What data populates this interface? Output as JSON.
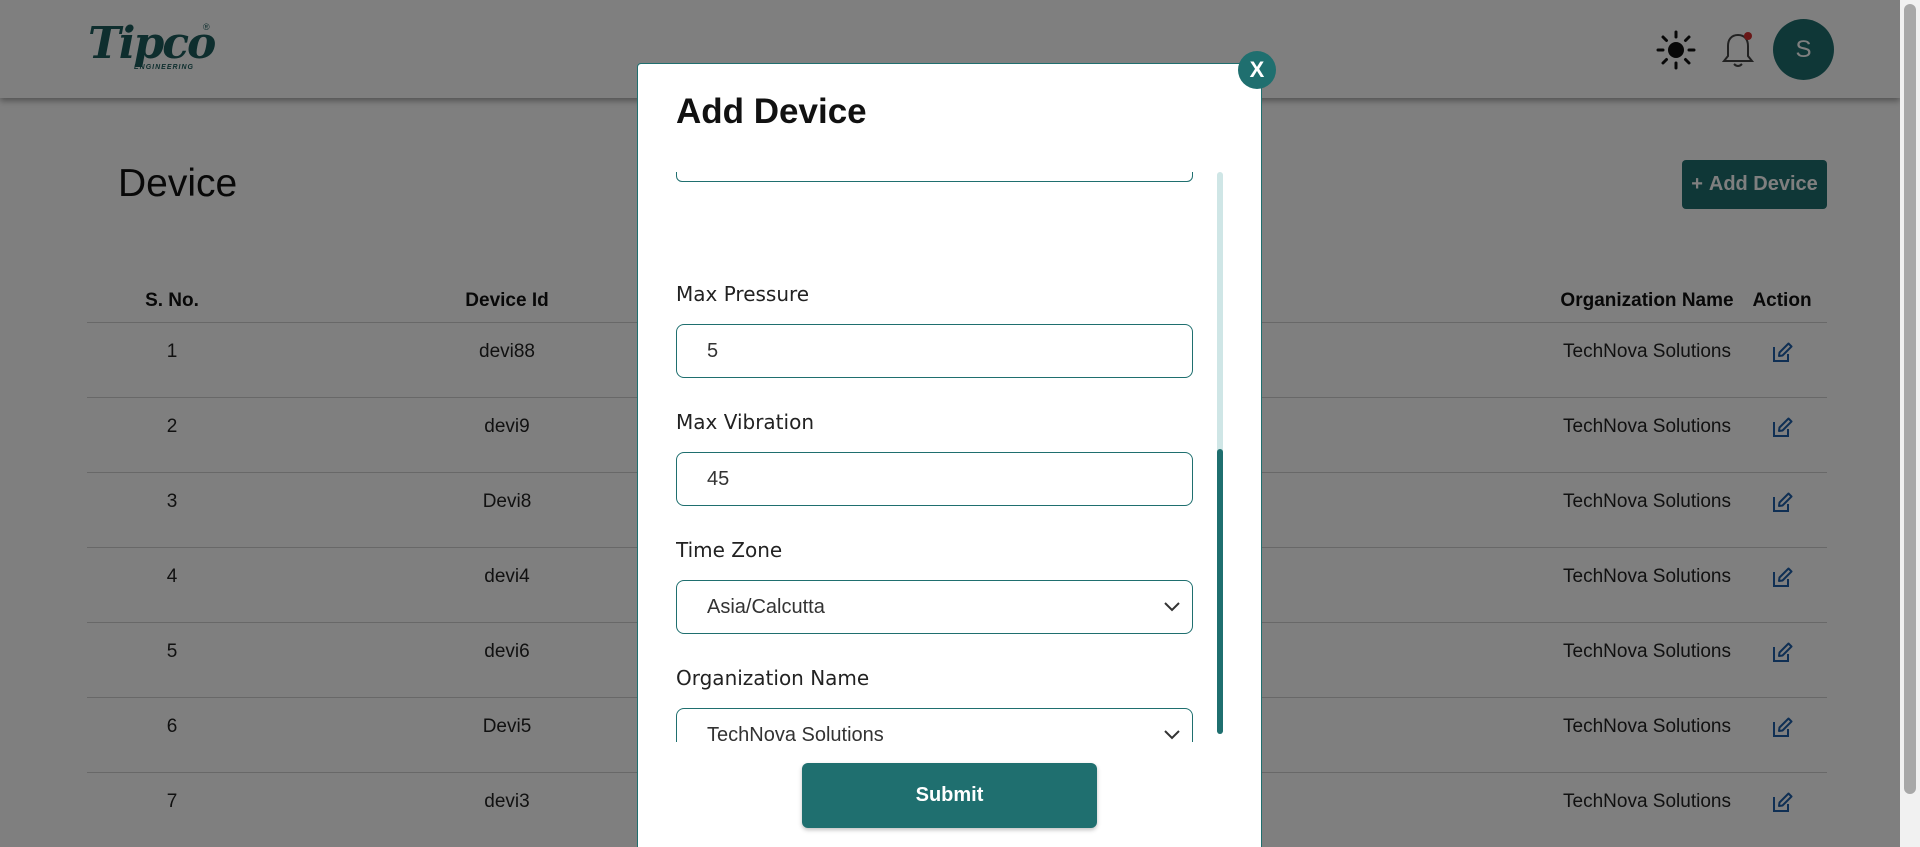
{
  "app": {
    "logo_text": "Tipco",
    "logo_sub": "ENGINEERING",
    "logo_reg": "®"
  },
  "header": {
    "avatar_initial": "S"
  },
  "page": {
    "title": "Device",
    "add_button_label": "Add Device",
    "add_button_plus": "+"
  },
  "table": {
    "headers": {
      "sno": "S. No.",
      "device_id": "Device Id",
      "organization": "Organization Name",
      "action": "Action"
    },
    "rows": [
      {
        "sno": "1",
        "device_id": "devi88",
        "organization": "TechNova Solutions"
      },
      {
        "sno": "2",
        "device_id": "devi9",
        "organization": "TechNova Solutions"
      },
      {
        "sno": "3",
        "device_id": "Devi8",
        "organization": "TechNova Solutions"
      },
      {
        "sno": "4",
        "device_id": "devi4",
        "organization": "TechNova Solutions"
      },
      {
        "sno": "5",
        "device_id": "devi6",
        "organization": "TechNova Solutions"
      },
      {
        "sno": "6",
        "device_id": "Devi5",
        "organization": "TechNova Solutions"
      },
      {
        "sno": "7",
        "device_id": "devi3",
        "organization": "TechNova Solutions"
      }
    ]
  },
  "modal": {
    "title": "Add Device",
    "close_label": "X",
    "fields": {
      "max_pressure": {
        "label": "Max Pressure",
        "value": "5"
      },
      "max_vibration": {
        "label": "Max Vibration",
        "value": "45"
      },
      "time_zone": {
        "label": "Time Zone",
        "value": "Asia/Calcutta"
      },
      "organization": {
        "label": "Organization Name",
        "value": "TechNova Solutions"
      }
    },
    "submit_label": "Submit"
  },
  "colors": {
    "primary": "#1f6f6f",
    "overlay": "rgba(0,0,0,0.5)",
    "notification_dot": "#d32f2f"
  }
}
